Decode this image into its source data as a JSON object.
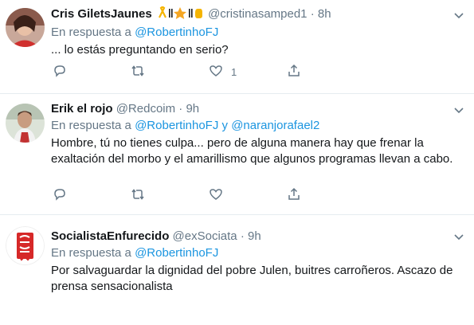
{
  "tweets": [
    {
      "name": "Cris GiletsJaunes",
      "badges": "🎗||⭐||✊",
      "handle": "@cristinasamped1",
      "dot": "·",
      "time": "8h",
      "reply_prefix": "En respuesta a",
      "reply_users": [
        "@RobertinhoFJ"
      ],
      "text": "... lo estás preguntando en serio?",
      "likes": "1"
    },
    {
      "name": "Erik el rojo",
      "handle": "@Redcoim",
      "dot": "·",
      "time": "9h",
      "reply_prefix": "En respuesta a",
      "reply_users": [
        "@RobertinhoFJ",
        "@naranjorafael2"
      ],
      "reply_and": "y",
      "text": "Hombre, tú no tienes culpa... pero de alguna manera hay que frenar la exaltación del morbo y el amarillismo que algunos programas llevan a cabo."
    },
    {
      "name": "SocialistaEnfurecido",
      "handle": "@exSociata",
      "dot": "·",
      "time": "9h",
      "reply_prefix": "En respuesta a",
      "reply_users": [
        "@RobertinhoFJ"
      ],
      "text": "Por salvaguardar la dignidad del pobre Julen, buitres carroñeros. Ascazo de prensa sensacionalista"
    }
  ],
  "colors": {
    "link": "#1b95e0",
    "muted": "#657786",
    "text": "#14171a",
    "divider": "#e6ecf0"
  },
  "icons": {
    "reply": "reply-icon",
    "retweet": "retweet-icon",
    "like": "heart-icon",
    "share": "share-icon",
    "more": "chevron-down-icon"
  }
}
